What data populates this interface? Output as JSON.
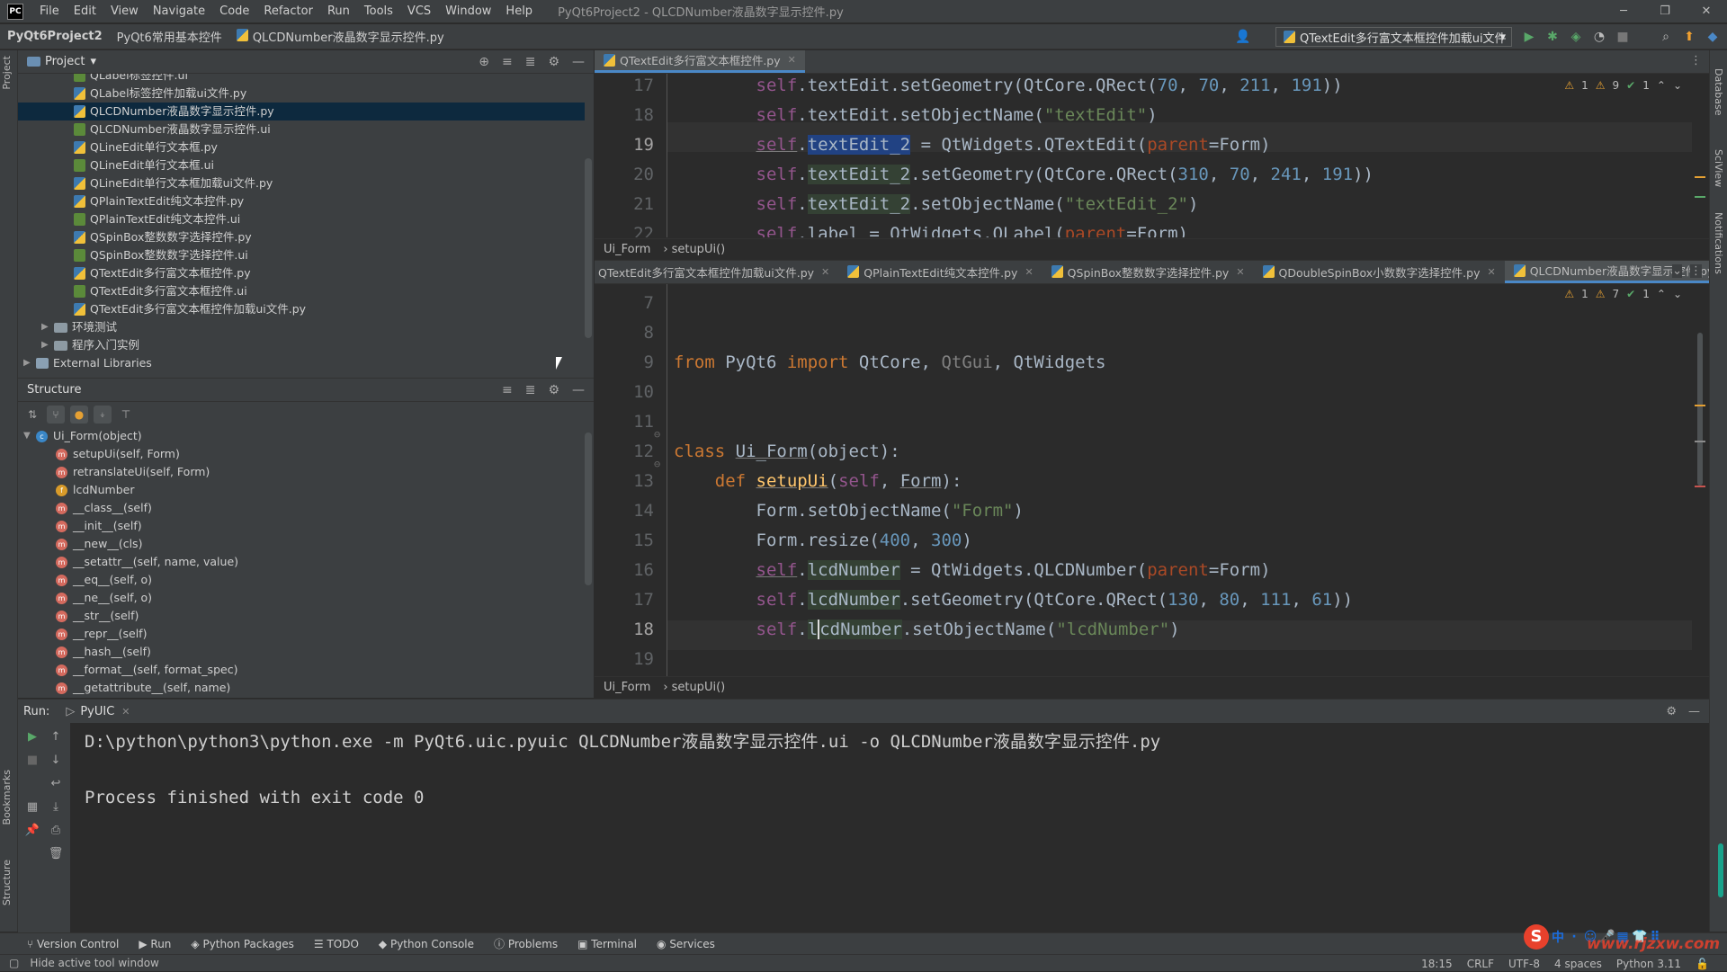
{
  "titlebar": {
    "logo": "PC",
    "menu": [
      "File",
      "Edit",
      "View",
      "Navigate",
      "Code",
      "Refactor",
      "Run",
      "Tools",
      "VCS",
      "Window",
      "Help"
    ],
    "title": "PyQt6Project2 - QLCDNumber液晶数字显示控件.py"
  },
  "navbar": {
    "project": "PyQt6Project2",
    "folder": "PyQt6常用基本控件",
    "file": "QLCDNumber液晶数字显示控件.py",
    "run_config": "QTextEdit多行富文本框控件加载ui文件"
  },
  "left_strip": {
    "project": "Project",
    "bookmarks": "Bookmarks",
    "structure": "Structure"
  },
  "right_strip": {
    "database": "Database",
    "sciview": "SciView",
    "notifications": "Notifications"
  },
  "project_panel": {
    "title": "Project",
    "files": [
      {
        "name": "QLabel标签控件.ui",
        "type": "ui"
      },
      {
        "name": "QLabel标签控件加载ui文件.py",
        "type": "py"
      },
      {
        "name": "QLCDNumber液晶数字显示控件.py",
        "type": "py"
      },
      {
        "name": "QLCDNumber液晶数字显示控件.ui",
        "type": "ui"
      },
      {
        "name": "QLineEdit单行文本框.py",
        "type": "py"
      },
      {
        "name": "QLineEdit单行文本框.ui",
        "type": "ui"
      },
      {
        "name": "QLineEdit单行文本框加载ui文件.py",
        "type": "py"
      },
      {
        "name": "QPlainTextEdit纯文本控件.py",
        "type": "py"
      },
      {
        "name": "QPlainTextEdit纯文本控件.ui",
        "type": "ui"
      },
      {
        "name": "QSpinBox整数数字选择控件.py",
        "type": "py"
      },
      {
        "name": "QSpinBox整数数字选择控件.ui",
        "type": "ui"
      },
      {
        "name": "QTextEdit多行富文本框控件.py",
        "type": "py"
      },
      {
        "name": "QTextEdit多行富文本框控件.ui",
        "type": "ui"
      },
      {
        "name": "QTextEdit多行富文本框控件加载ui文件.py",
        "type": "py"
      }
    ],
    "folders": [
      "环境测试",
      "程序入门实例"
    ],
    "libraries": "External Libraries"
  },
  "structure_panel": {
    "title": "Structure",
    "root": "Ui_Form(object)",
    "items": [
      {
        "name": "setupUi(self, Form)",
        "kind": "m",
        "dim": false
      },
      {
        "name": "retranslateUi(self, Form)",
        "kind": "m",
        "dim": false
      },
      {
        "name": "lcdNumber",
        "kind": "f",
        "dim": false
      },
      {
        "name": "__class__(self)",
        "kind": "m",
        "dim": true
      },
      {
        "name": "__init__(self)",
        "kind": "m",
        "dim": true
      },
      {
        "name": "__new__(cls)",
        "kind": "m",
        "dim": true
      },
      {
        "name": "__setattr__(self, name, value)",
        "kind": "m",
        "dim": true
      },
      {
        "name": "__eq__(self, o)",
        "kind": "m",
        "dim": true
      },
      {
        "name": "__ne__(self, o)",
        "kind": "m",
        "dim": true
      },
      {
        "name": "__str__(self)",
        "kind": "m",
        "dim": true
      },
      {
        "name": "__repr__(self)",
        "kind": "m",
        "dim": true
      },
      {
        "name": "__hash__(self)",
        "kind": "m",
        "dim": true
      },
      {
        "name": "__format__(self, format_spec)",
        "kind": "m",
        "dim": true
      },
      {
        "name": "__getattribute__(self, name)",
        "kind": "m",
        "dim": true
      }
    ]
  },
  "editor_top": {
    "tab": "QTextEdit多行富文本框控件.py",
    "line_numbers": [
      "17",
      "18",
      "19",
      "20",
      "21",
      "22"
    ],
    "warnings": {
      "warn1": "1",
      "warn2": "9",
      "ok": "1"
    },
    "breadcrumb": [
      "Ui_Form",
      "setupUi()"
    ]
  },
  "editor_bottom": {
    "tabs": [
      "QTextEdit多行富文本框控件加载ui文件.py",
      "QPlainTextEdit纯文本控件.py",
      "QSpinBox整数数字选择控件.py",
      "QDoubleSpinBox小数数字选择控件.py",
      "QLCDNumber液晶数字显示控件.py"
    ],
    "line_numbers": [
      "7",
      "8",
      "9",
      "10",
      "11",
      "12",
      "13",
      "14",
      "15",
      "16",
      "17",
      "18",
      "19"
    ],
    "warnings": {
      "warn1": "1",
      "warn2": "7",
      "ok": "1"
    },
    "breadcrumb": [
      "Ui_Form",
      "setupUi()"
    ]
  },
  "run_panel": {
    "label": "Run:",
    "tab": "PyUIC",
    "command": "D:\\python\\python3\\python.exe -m PyQt6.uic.pyuic QLCDNumber液晶数字显示控件.ui -o QLCDNumber液晶数字显示控件.py",
    "result": "Process finished with exit code 0"
  },
  "bottom_tabs": [
    "Version Control",
    "Run",
    "Python Packages",
    "TODO",
    "Python Console",
    "Problems",
    "Terminal",
    "Services"
  ],
  "status": {
    "hint": "Hide active tool window",
    "position": "18:15",
    "line_sep": "CRLF",
    "encoding": "UTF-8",
    "indent": "4 spaces",
    "interpreter": "Python 3.11"
  },
  "ime": {
    "logo": "S",
    "keys": [
      "中",
      "·",
      "☺",
      "🎤",
      "▦",
      "👕",
      "⠿"
    ],
    "watermark": "www.rjzxw.com"
  }
}
